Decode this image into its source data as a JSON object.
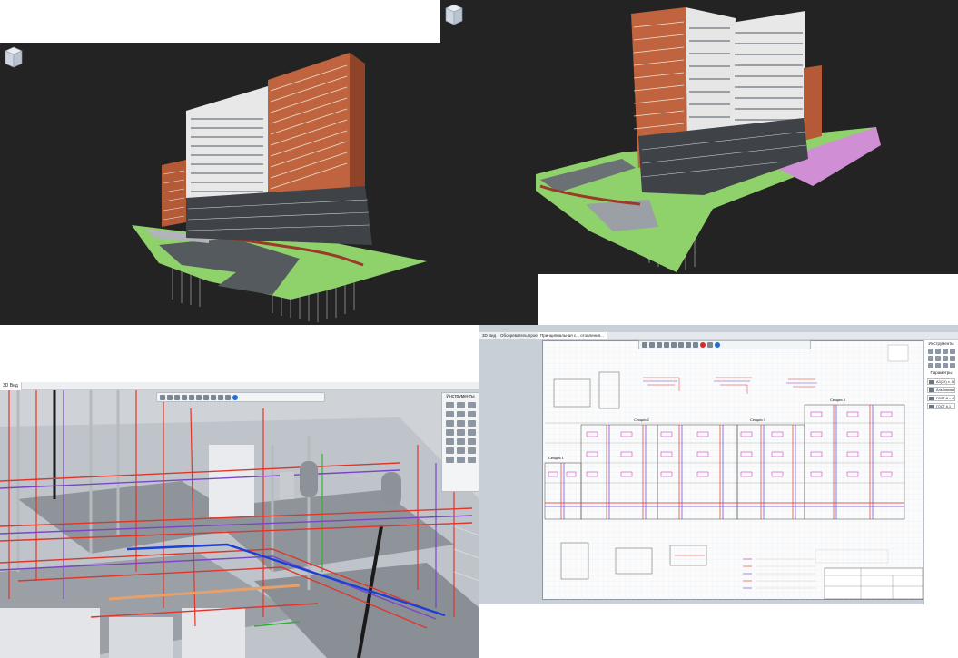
{
  "top_left": {
    "viewcube": {
      "top": "Сверху"
    }
  },
  "top_right": {},
  "bottom_left": {
    "tab": "3D Вид",
    "tools_title": "Инструменты"
  },
  "bottom_right": {
    "tabs": [
      "3D Вид",
      "Обозреватель проекта",
      "Принципиальная с... отопления..."
    ],
    "tools_title": "Инструменты",
    "params_title": "Параметры",
    "params": [
      "A3(3Х) x .586...",
      "Альбомная",
      "ГОСТ-6 – Лис...",
      "ГОСТ 6.1"
    ],
    "sections": [
      "Секция 1",
      "Секция 2",
      "Секция 3",
      "Секция 4"
    ]
  }
}
